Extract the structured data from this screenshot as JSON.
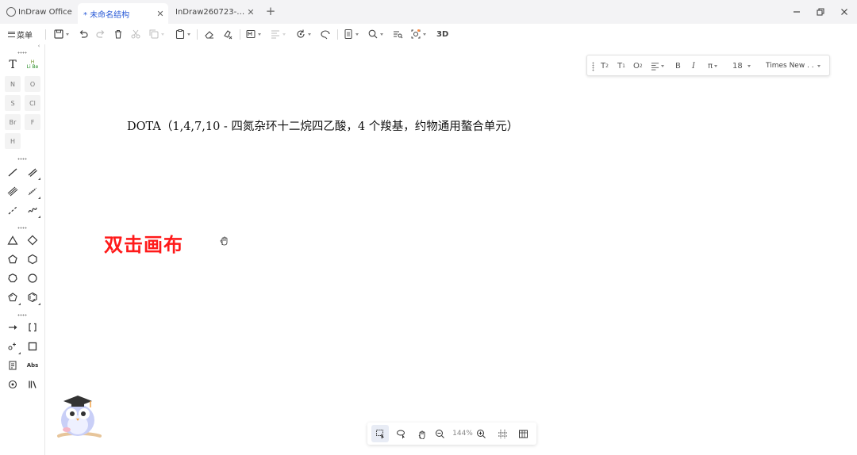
{
  "app": {
    "name": "InDraw Office"
  },
  "tabs": [
    {
      "label": "* 未命名结构",
      "active": true
    },
    {
      "label": "InDraw260723-…",
      "active": false
    }
  ],
  "window_controls": [
    "minimize-icon",
    "restore-icon",
    "close-icon"
  ],
  "toolbar": {
    "menu_label": "菜单",
    "label_3d": "3D",
    "icons": [
      "save-icon",
      "undo-icon",
      "redo-icon",
      "delete-icon",
      "cut-icon",
      "copy-icon",
      "paste-icon",
      "eraser-icon",
      "clear-format-icon",
      "templates-icon",
      "align-icon",
      "rotate-icon",
      "lasso-icon",
      "page-icon",
      "search-icon",
      "zoom-fit-icon",
      "recognize-icon"
    ]
  },
  "left_panel": {
    "text_tool": "T",
    "element_tool": [
      "H",
      "Li Be"
    ],
    "atoms": [
      "N",
      "O",
      "S",
      "Cl",
      "Br",
      "F",
      "H"
    ],
    "label_abs": "Abs"
  },
  "text_format_bar": {
    "superscript_label": "T",
    "subscript_label": "T",
    "chem_label": "O",
    "bold_label": "B",
    "italic_label": "I",
    "pi_label": "π",
    "font_size": "18",
    "font_family": "Times New . ."
  },
  "canvas": {
    "text": "DOTA（1,4,7,10 - 四氮杂环十二烷四乙酸，4 个羧基，约物通用螯合单元）",
    "hint": "双击画布",
    "hint_color": "#ff1a1a"
  },
  "bottom_bar": {
    "zoom": "144%",
    "tools": [
      "select-icon",
      "lasso-select-icon",
      "hand-icon",
      "zoom-out-icon",
      "zoom-in-icon",
      "grid-icon",
      "table-icon"
    ]
  },
  "colors": {
    "accent": "#2a5bd7",
    "titlebar_bg": "#f3f3f5"
  }
}
